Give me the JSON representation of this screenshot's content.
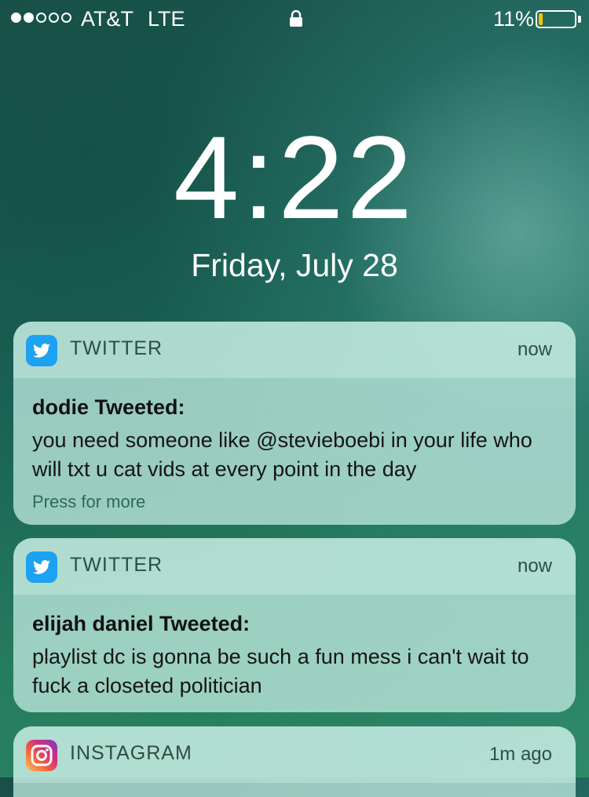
{
  "status_bar": {
    "signal_bars_filled": 2,
    "signal_bars_total": 5,
    "carrier": "AT&T",
    "network": "LTE",
    "battery_percent_label": "11%",
    "battery_level": 0.11,
    "battery_color": "#f2c500"
  },
  "lock_screen": {
    "time": "4:22",
    "date": "Friday, July 28"
  },
  "notifications": [
    {
      "app": "TWITTER",
      "icon": "twitter-bird-icon",
      "time": "now",
      "title": "dodie Tweeted:",
      "message": "you need someone like @stevieboebi in your life who will txt u cat vids at every point in the day",
      "more": "Press for more"
    },
    {
      "app": "TWITTER",
      "icon": "twitter-bird-icon",
      "time": "now",
      "title": "elijah daniel Tweeted:",
      "message": "playlist dc is gonna be such a fun mess i can't wait to fuck a closeted politician"
    },
    {
      "app": "INSTAGRAM",
      "icon": "instagram-icon",
      "time": "1m ago"
    }
  ],
  "colors": {
    "twitter": "#1da1f2"
  }
}
